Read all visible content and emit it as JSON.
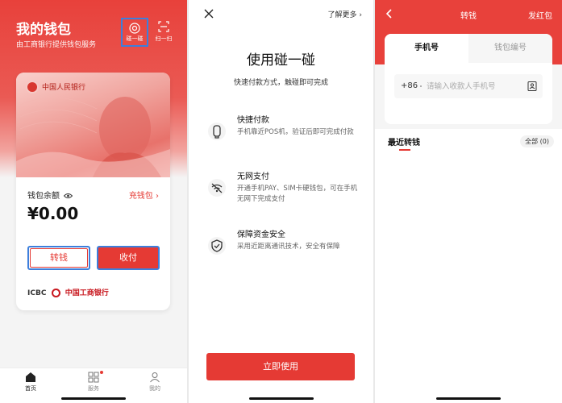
{
  "wallet": {
    "title": "我的钱包",
    "subtitle": "由工商银行提供钱包服务",
    "tap_label": "碰一碰",
    "scan_label": "扫一扫",
    "bank_name": "中国人民银行",
    "balance_label": "钱包余额",
    "recharge_label": "充钱包 ›",
    "balance": "¥0.00",
    "transfer_btn": "转钱",
    "pay_btn": "收付",
    "provider_brand": "ICBC",
    "provider_name": "中国工商银行",
    "tabs": [
      {
        "label": "首页",
        "icon": "home-icon",
        "active": true
      },
      {
        "label": "服务",
        "icon": "grid-icon",
        "active": false
      },
      {
        "label": "我的",
        "icon": "user-icon",
        "active": false
      }
    ],
    "accent": "#e8413b"
  },
  "tap": {
    "learn_more": "了解更多 ›",
    "title": "使用碰一碰",
    "subtitle": "快速付款方式，触碰即可完成",
    "features": [
      {
        "title": "快捷付款",
        "desc": "手机靠近POS机，验证后即可完成付款",
        "icon": "nfc-icon"
      },
      {
        "title": "无网支付",
        "desc": "开通手机PAY、SIM卡硬钱包，可在手机无网下完成支付",
        "icon": "no-network-icon"
      },
      {
        "title": "保障资金安全",
        "desc": "采用近距离通讯技术，安全有保障",
        "icon": "shield-check-icon"
      }
    ],
    "use_btn": "立即使用"
  },
  "transfer": {
    "title": "转钱",
    "red_packet": "发红包",
    "tab_phone": "手机号",
    "tab_wallet_id": "钱包编号",
    "country_code": "+86",
    "phone_placeholder": "请输入收款人手机号",
    "recent_title": "最近转钱",
    "recent_all": "全部 (0)"
  }
}
